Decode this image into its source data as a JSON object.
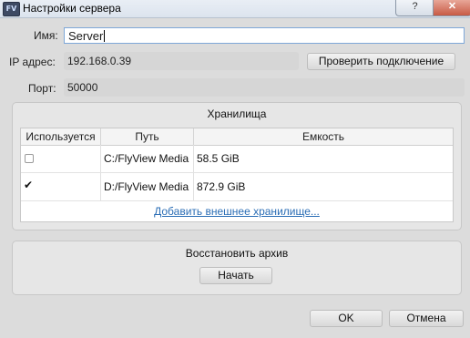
{
  "window": {
    "title": "Настройки сервера",
    "app_icon_text": "FV",
    "help_glyph": "?",
    "close_glyph": "✕"
  },
  "form": {
    "name_label": "Имя:",
    "name_value": "Server",
    "ip_label": "IP адрес:",
    "ip_value": "192.168.0.39",
    "check_connection_label": "Проверить подключение",
    "port_label": "Порт:",
    "port_value": "50000"
  },
  "storage": {
    "title": "Хранилища",
    "columns": [
      "Используется",
      "Путь",
      "Емкость"
    ],
    "rows": [
      {
        "used": false,
        "path": "C:/FlyView Media",
        "capacity": "58.5 GiB"
      },
      {
        "used": true,
        "path": "D:/FlyView Media",
        "capacity": "872.9 GiB"
      }
    ],
    "add_external_link": "Добавить внешнее хранилище..."
  },
  "restore": {
    "title": "Восстановить архив",
    "start_label": "Начать"
  },
  "footer": {
    "ok_label": "OK",
    "cancel_label": "Отмена"
  },
  "colors": {
    "link": "#2a6db5",
    "field_border": "#7ea7d8",
    "close_button": "#c75a45"
  }
}
